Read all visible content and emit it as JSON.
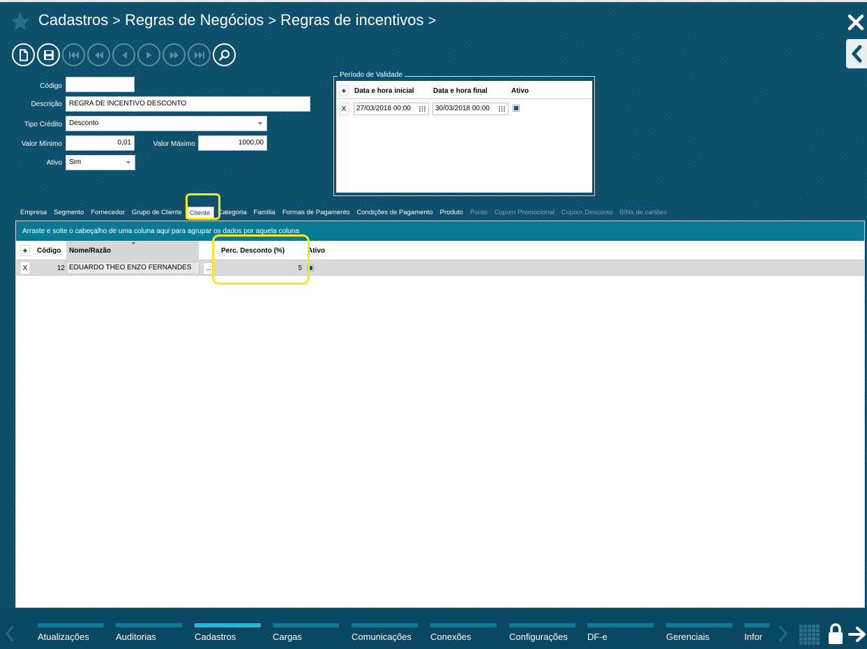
{
  "breadcrumb": {
    "items": [
      "Cadastros",
      "Regras de Negócios",
      "Regras de incentivos"
    ],
    "separator": ">"
  },
  "form": {
    "codigo_label": "Código",
    "codigo_value": "",
    "descricao_label": "Descrição",
    "descricao_value": "REGRA DE INCENTIVO DESCONTO",
    "tipo_credito_label": "Tipo Crédito",
    "tipo_credito_value": "Desconto",
    "valor_minimo_label": "Valor Mínimo",
    "valor_minimo_value": "0,01",
    "valor_maximo_label": "Valor Máximo",
    "valor_maximo_value": "1000,00",
    "ativo_label": "Ativo",
    "ativo_value": "Sim"
  },
  "validity": {
    "legend": "Período de Validade",
    "add": "+",
    "headers": [
      "Data e hora inicial",
      "Data e hora final",
      "Ativo"
    ],
    "rows": [
      {
        "remove": "X",
        "start": "27/03/2018 00:00",
        "end": "30/03/2018 00:00",
        "active": true
      }
    ]
  },
  "tabs": [
    {
      "label": "Empresa",
      "state": "normal"
    },
    {
      "label": "Segmento",
      "state": "normal"
    },
    {
      "label": "Fornecedor",
      "state": "normal"
    },
    {
      "label": "Grupo de Cliente",
      "state": "normal"
    },
    {
      "label": "Cliente",
      "state": "active"
    },
    {
      "label": "Categoria",
      "state": "normal"
    },
    {
      "label": "Família",
      "state": "normal"
    },
    {
      "label": "Formas de Pagamento",
      "state": "normal"
    },
    {
      "label": "Condições de Pagamento",
      "state": "normal"
    },
    {
      "label": "Produto",
      "state": "normal"
    },
    {
      "label": "Ponto",
      "state": "disabled"
    },
    {
      "label": "Cupom Promocional",
      "state": "disabled"
    },
    {
      "label": "Cupom Desconto",
      "state": "disabled"
    },
    {
      "label": "BINs de cartões",
      "state": "disabled"
    }
  ],
  "grid": {
    "group_hint": "Arraste e solte o cabeçalho de uma coluna aqui para agrupar os dados por aquela coluna",
    "add": "+",
    "headers": {
      "codigo": "Código",
      "nome": "Nome/Razão",
      "perc": "Perc. Desconto (%)",
      "ativo": "Ativo"
    },
    "rows": [
      {
        "remove": "X",
        "codigo": "12",
        "nome": "EDUARDO THEO ENZO FERNANDES",
        "lookup": "...",
        "perc": "5",
        "ativo": true
      }
    ]
  },
  "bottom_nav": {
    "items": [
      "Atualizações",
      "Auditorias",
      "Cadastros",
      "Cargas",
      "Comunicações",
      "Conexões",
      "Configurações",
      "DF-e",
      "Gerenciais",
      "Infor"
    ],
    "active": "Cadastros"
  },
  "colors": {
    "background": "#0b4f6c",
    "accent": "#23b8d8",
    "highlight": "#f3ea1d"
  }
}
